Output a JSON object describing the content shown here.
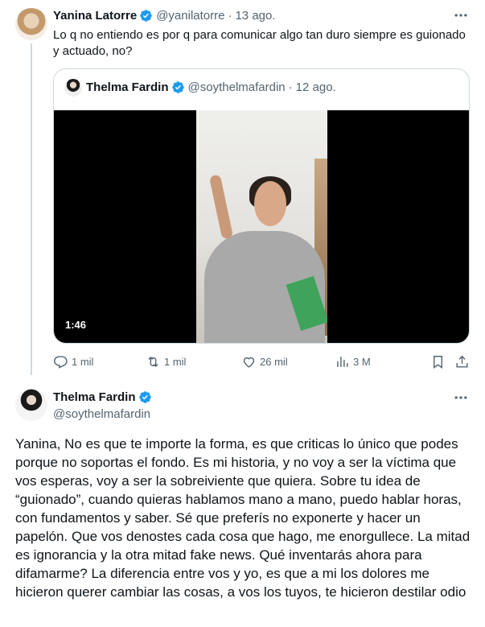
{
  "tweet1": {
    "name": "Yanina Latorre",
    "handle": "@yanilatorre",
    "separator": "·",
    "time": "13 ago.",
    "text": "Lo q no entiendo es por q para comunicar algo tan duro siempre es guionado y actuado, no?",
    "quote": {
      "name": "Thelma Fardin",
      "handle": "@soythelmafardin",
      "separator": "·",
      "time": "12 ago.",
      "video_duration": "1:46"
    },
    "actions": {
      "replies": "1 mil",
      "retweets": "1 mil",
      "likes": "26 mil",
      "views": "3 M"
    }
  },
  "tweet2": {
    "name": "Thelma Fardin",
    "handle": "@soythelmafardin",
    "text": "Yanina, No es que te importe la forma, es que criticas lo único que podes porque no soportas el fondo. Es mi historia, y no voy a ser la víctima que vos esperas, voy a ser la sobreiviente que quiera. Sobre tu idea de “guionado”, cuando quieras hablamos mano a mano, puedo hablar horas, con fundamentos y saber. Sé que preferís no exponerte y hacer un papelón. Que vos denostes cada cosa que hago, me enorgullece. La mitad es ignorancia y la otra mitad fake news. Qué inventarás ahora para difamarme? La diferencia entre vos y yo, es que a mi los dolores me hicieron querer cambiar las cosas, a vos los tuyos, te hicieron destilar odio"
  },
  "colors": {
    "verified": "#1d9bf0",
    "secondary_text": "#536471",
    "border": "#cfd9de"
  },
  "icons": [
    "verified-badge-icon",
    "more-icon",
    "reply-icon",
    "retweet-icon",
    "like-icon",
    "views-icon",
    "bookmark-icon",
    "share-icon"
  ]
}
